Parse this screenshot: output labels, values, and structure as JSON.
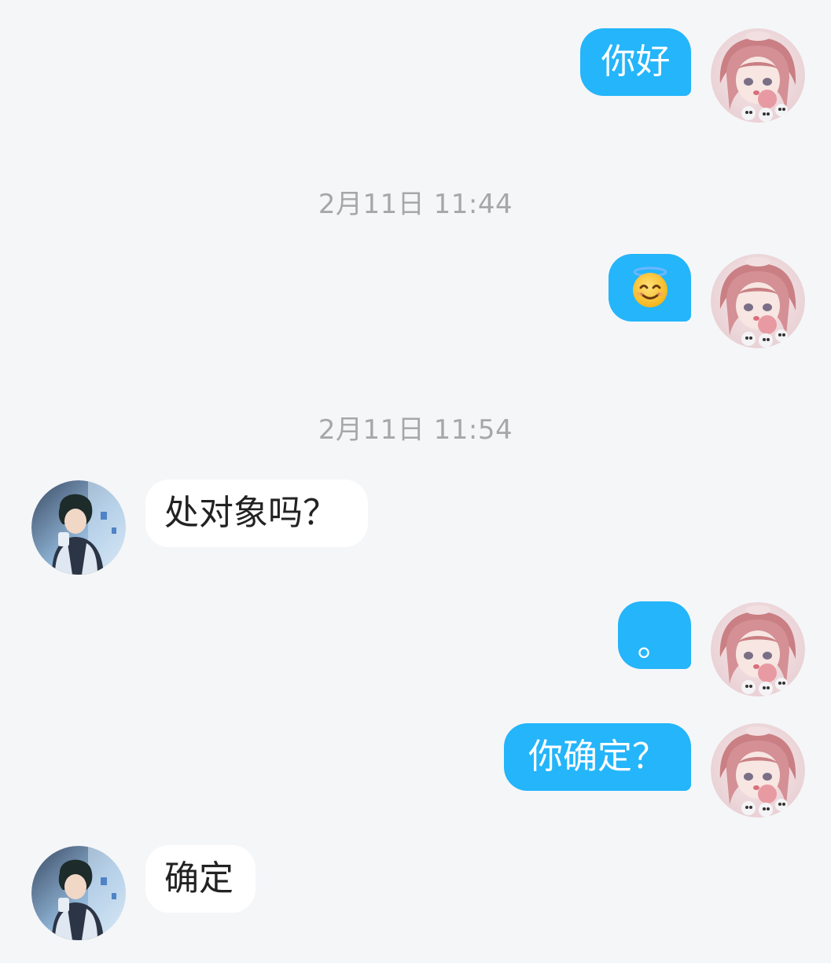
{
  "chat": {
    "messages": [
      {
        "side": "right",
        "text": "你好"
      },
      {
        "side": "right",
        "emoji": "smiling-face-with-halo"
      },
      {
        "side": "left",
        "text": "处对象吗？"
      },
      {
        "side": "right",
        "text": "。"
      },
      {
        "side": "right",
        "text": "你确定？"
      },
      {
        "side": "left",
        "text": "确定"
      }
    ],
    "timestamps": [
      "2月11日 11:44",
      "2月11日 11:54"
    ]
  },
  "colors": {
    "background": "#f5f6f8",
    "my_bubble": "#24b5fb",
    "their_bubble": "#ffffff",
    "timestamp_text": "#a7a7a7"
  },
  "icons": {
    "my_avatar": "anime-girl-avatar",
    "their_avatar": "anime-boy-avatar"
  }
}
